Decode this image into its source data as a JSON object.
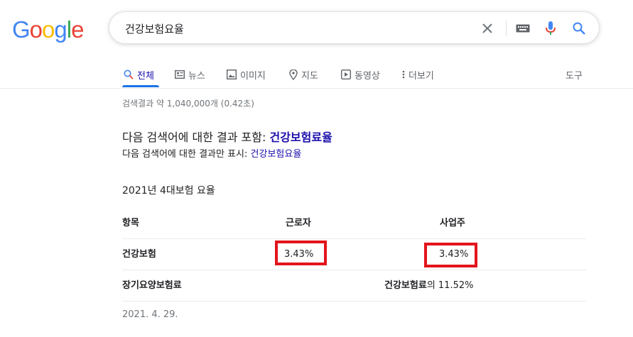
{
  "logo": {
    "text": "Google",
    "letters": [
      "G",
      "o",
      "o",
      "g",
      "l",
      "e"
    ],
    "colors": [
      "#4285f4",
      "#ea4335",
      "#fbbc05",
      "#4285f4",
      "#34a853",
      "#ea4335"
    ]
  },
  "search": {
    "query": "건강보험요율",
    "icons": [
      "clear-icon",
      "keyboard-icon",
      "mic-icon",
      "search-icon"
    ]
  },
  "tabs": [
    {
      "label": "전체",
      "icon": "search-icon",
      "active": true
    },
    {
      "label": "뉴스",
      "icon": "news-icon"
    },
    {
      "label": "이미지",
      "icon": "image-icon"
    },
    {
      "label": "지도",
      "icon": "map-pin-icon"
    },
    {
      "label": "동영상",
      "icon": "video-icon"
    },
    {
      "label": "더보기",
      "icon": "more-icon"
    }
  ],
  "tools_label": "도구",
  "stats": "검색결과 약 1,040,000개 (0.42초)",
  "spelling": {
    "prefix": "다음 검색어에 대한 결과 포함: ",
    "term": "건강보험료율",
    "only_prefix": "다음 검색어에 대한 결과만 표시: ",
    "only_term": "건강보험요율"
  },
  "featured": {
    "title": "2021년 4대보험 요율",
    "headers": [
      "항목",
      "근로자",
      "사업주"
    ],
    "rows": [
      {
        "label": "건강보험",
        "worker": "3.43%",
        "employer": "3.43%",
        "highlight_color": "#e3141b"
      },
      {
        "label": "장기요양보험료",
        "merged_bold": "건강보험료",
        "merged_rest": "의 11.52%"
      }
    ],
    "date": "2021. 4. 29."
  }
}
